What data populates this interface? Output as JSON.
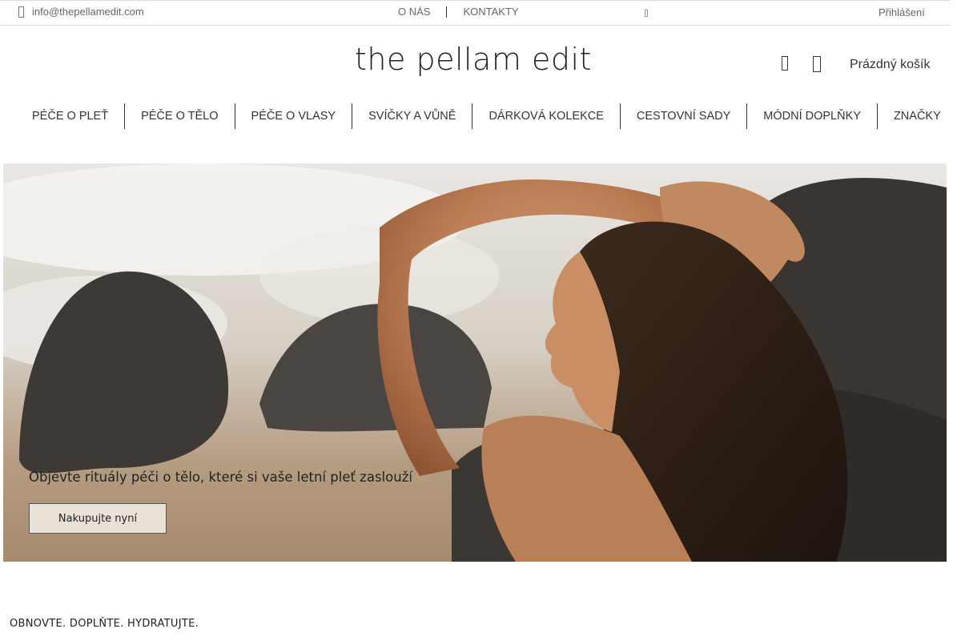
{
  "topbar": {
    "email": "info@thepellamedit.com",
    "links": [
      "O NÁS",
      "KONTAKTY"
    ],
    "login": "Přihlášení"
  },
  "header": {
    "logo": "the pellam edit",
    "cart_label": "Prázdný košík"
  },
  "nav": {
    "items": [
      "PÉČE O PLEŤ",
      "PÉČE O TĚLO",
      "PÉČE O VLASY",
      "SVÍČKY A VŮNĚ",
      "DÁRKOVÁ KOLEKCE",
      "CESTOVNÍ SADY",
      "MÓDNÍ DOPLŇKY",
      "ZNAČKY"
    ]
  },
  "hero": {
    "tagline": "Objevte rituály péči o tělo, které si vaše letní pleť zaslouží",
    "cta_label": "Nakupujte nyní"
  },
  "section": {
    "heading": "OBNOVTE. DOPLŇTE. HYDRATUJTE."
  },
  "icons": {
    "email": "mail-icon",
    "search": "search-icon",
    "cart": "cart-icon"
  }
}
